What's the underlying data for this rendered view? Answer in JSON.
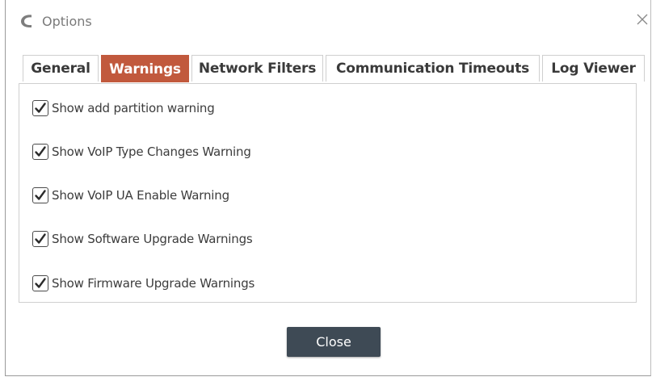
{
  "window": {
    "title": "Options"
  },
  "tabs": [
    {
      "label": "General",
      "active": false
    },
    {
      "label": "Warnings",
      "active": true
    },
    {
      "label": "Network Filters",
      "active": false
    },
    {
      "label": "Communication Timeouts",
      "active": false
    },
    {
      "label": "Log Viewer",
      "active": false
    }
  ],
  "warnings": [
    {
      "label": "Show add partition warning",
      "checked": true
    },
    {
      "label": "Show VoIP Type Changes Warning",
      "checked": true
    },
    {
      "label": "Show VoIP UA Enable Warning",
      "checked": true
    },
    {
      "label": "Show Software Upgrade Warnings",
      "checked": true
    },
    {
      "label": "Show Firmware Upgrade Warnings",
      "checked": true
    }
  ],
  "footer": {
    "close_label": "Close"
  },
  "colors": {
    "accent": "#c1593d",
    "button": "#3e4a55"
  },
  "icons": {
    "app": "app-logo-icon",
    "close": "close-icon",
    "check": "checkmark-icon"
  }
}
